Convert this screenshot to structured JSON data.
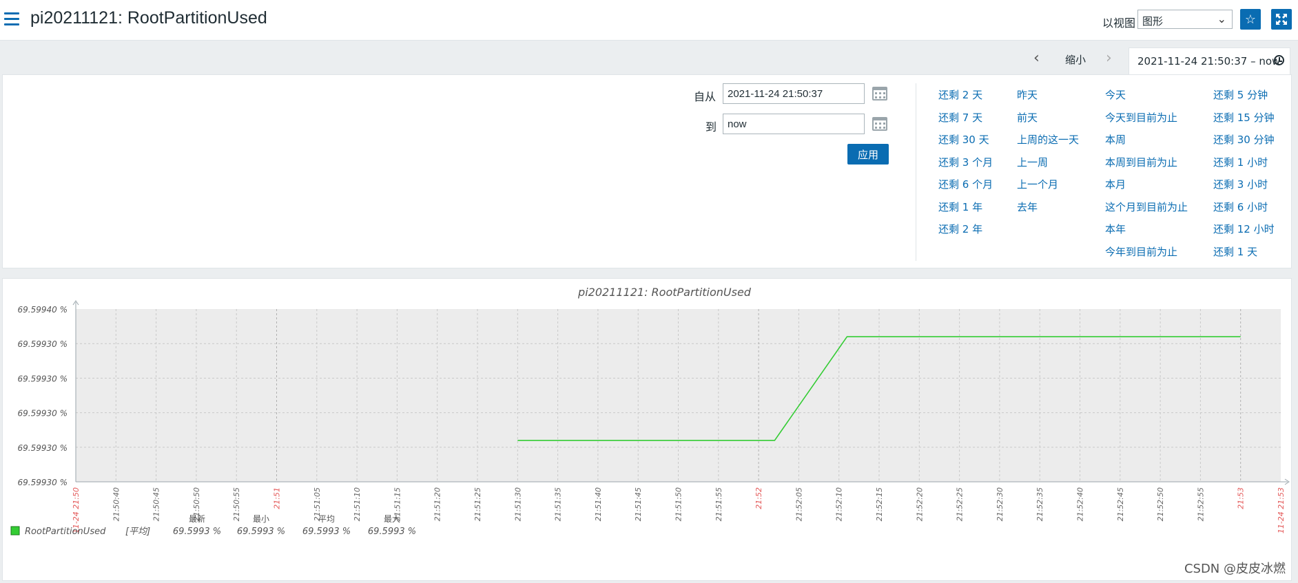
{
  "header": {
    "title": "pi20211121: RootPartitionUsed",
    "view_label": "以视图",
    "view_select": "图形"
  },
  "filter_tabs": {
    "zoom_out": "缩小",
    "time_range": "2021-11-24 21:50:37 – now"
  },
  "filter": {
    "from_label": "自从",
    "from_value": "2021-11-24 21:50:37",
    "to_label": "到",
    "to_value": "now",
    "apply_label": "应用"
  },
  "quick_ranges": {
    "col1": [
      "还剩 2 天",
      "还剩 7 天",
      "还剩 30 天",
      "还剩 3 个月",
      "还剩 6 个月",
      "还剩 1 年",
      "还剩 2 年"
    ],
    "col2": [
      "昨天",
      "前天",
      "上周的这一天",
      "上一周",
      "上一个月",
      "去年"
    ],
    "col3": [
      "今天",
      "今天到目前为止",
      "本周",
      "本周到目前为止",
      "本月",
      "这个月到目前为止",
      "本年",
      "今年到目前为止"
    ],
    "col4": [
      "还剩 5 分钟",
      "还剩 15 分钟",
      "还剩 30 分钟",
      "还剩 1 小时",
      "还剩 3 小时",
      "还剩 6 小时",
      "还剩 12 小时",
      "还剩 1 天"
    ]
  },
  "chart_data": {
    "type": "line",
    "title": "pi20211121: RootPartitionUsed",
    "y_tick_labels": [
      "69.59940 %",
      "69.59930 %",
      "69.59930 %",
      "69.59930 %",
      "69.59930 %",
      "69.59930 %"
    ],
    "x_tick_labels": [
      "11-24 21:50",
      "21:50:40",
      "21:50:45",
      "21:50:50",
      "21:50:55",
      "21:51",
      "21:51:05",
      "21:51:10",
      "21:51:15",
      "21:51:20",
      "21:51:25",
      "21:51:30",
      "21:51:35",
      "21:51:40",
      "21:51:45",
      "21:51:50",
      "21:51:55",
      "21:52",
      "21:52:05",
      "21:52:10",
      "21:52:15",
      "21:52:20",
      "21:52:25",
      "21:52:30",
      "21:52:35",
      "21:52:40",
      "21:52:45",
      "21:52:50",
      "21:52:55",
      "21:53",
      "11-24 21:53"
    ],
    "x_tick_highlight": [
      true,
      false,
      false,
      false,
      false,
      true,
      false,
      false,
      false,
      false,
      false,
      false,
      false,
      false,
      false,
      false,
      false,
      true,
      false,
      false,
      false,
      false,
      false,
      false,
      false,
      false,
      false,
      false,
      false,
      true,
      true
    ],
    "series": [
      {
        "name": "RootPartitionUsed",
        "color": "#33cc33",
        "points": [
          {
            "t": "21:51:30",
            "level": 1.2
          },
          {
            "t": "21:52:02",
            "level": 1.2
          },
          {
            "t": "21:52:11",
            "level": 4.2
          },
          {
            "t": "21:53",
            "level": 4.2
          }
        ]
      }
    ],
    "y_levels": 5,
    "grid": true,
    "legend": {
      "name": "RootPartitionUsed",
      "func": "[平均]",
      "headers": [
        "最新",
        "最小",
        "平均",
        "最大"
      ],
      "values": [
        "69.5993 %",
        "69.5993 %",
        "69.5993 %",
        "69.5993 %"
      ]
    }
  },
  "watermark": "CSDN @皮皮冰燃"
}
